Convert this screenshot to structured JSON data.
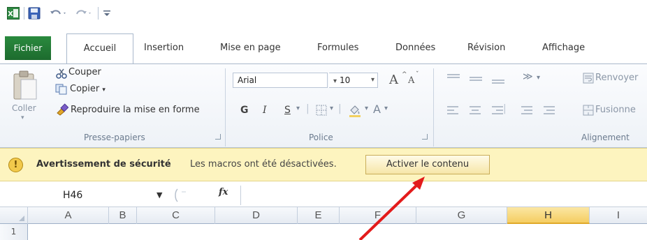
{
  "tabs": {
    "file": "Fichier",
    "home": "Accueil",
    "insert": "Insertion",
    "page_layout": "Mise en page",
    "formulas": "Formules",
    "data": "Données",
    "review": "Révision",
    "view": "Affichage"
  },
  "clipboard": {
    "paste": "Coller",
    "cut": "Couper",
    "copy": "Copier",
    "copy_dropdown": "▾",
    "format_painter": "Reproduire la mise en forme",
    "group_label": "Presse-papiers"
  },
  "font": {
    "name": "Arial",
    "size": "10",
    "grow": "A",
    "shrink": "A",
    "bold": "G",
    "italic": "I",
    "underline": "S",
    "font_color_glyph": "A",
    "group_label": "Police"
  },
  "alignment": {
    "wrap_text": "Renvoyer",
    "merge": "Fusionne",
    "group_label": "Alignement"
  },
  "security_bar": {
    "title": "Avertissement de sécurité",
    "message": "Les macros ont été désactivées.",
    "button": "Activer le contenu",
    "icon_glyph": "!"
  },
  "formula_bar": {
    "name_box": "H46",
    "fx": "fx",
    "formula": ""
  },
  "columns": [
    "A",
    "B",
    "C",
    "D",
    "E",
    "F",
    "G",
    "H",
    "I"
  ],
  "rows": [
    "1"
  ],
  "colors": {
    "file_tab": "#1d6b2e",
    "security_bar": "#fdf4bf",
    "selected_column": "#f5cd62",
    "annotation_arrow": "#e31b1b"
  }
}
